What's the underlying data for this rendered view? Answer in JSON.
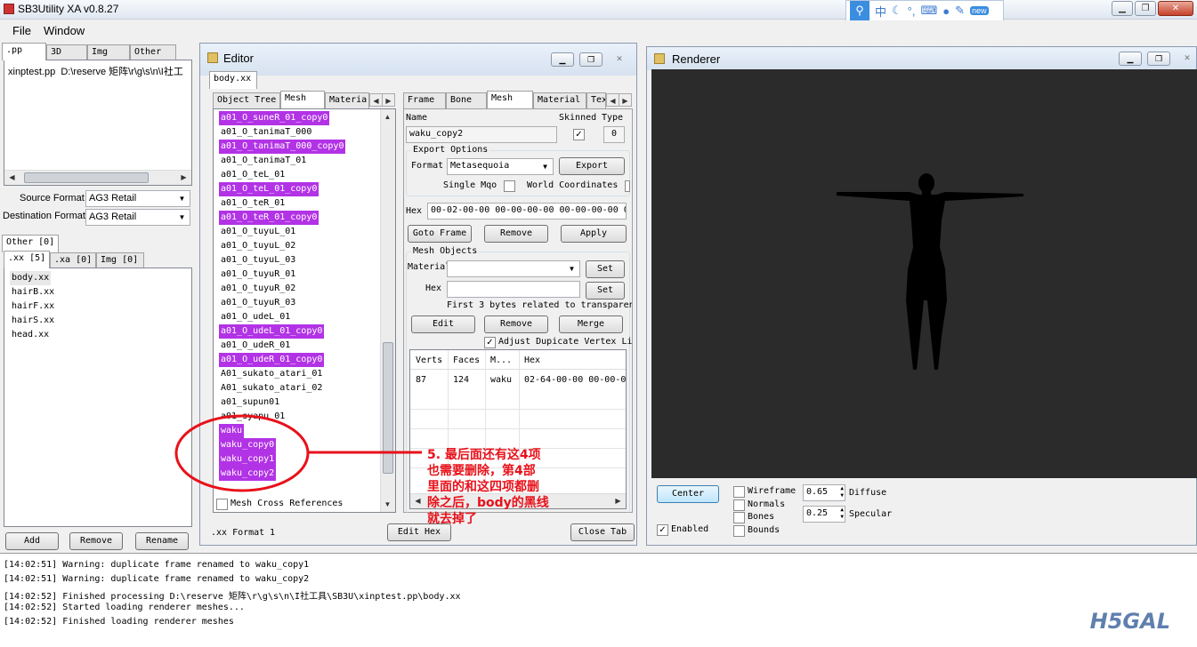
{
  "app": {
    "title": "SB3Utility XA v0.8.27"
  },
  "ime": {
    "items": [
      "中",
      "☾",
      "°,",
      "⌨",
      "●",
      "✎",
      "new"
    ]
  },
  "menu": {
    "file": "File",
    "window": "Window"
  },
  "pp": {
    "tabs": [
      ".pp",
      "3D",
      "Img",
      "Other"
    ],
    "file_name": "xinptest.pp",
    "file_path": "D:\\reserve 矩阵\\r\\g\\s\\n\\I社工",
    "source_format_label": "Source Format",
    "source_format_value": "AG3 Retail",
    "dest_format_label": "Destination Format",
    "dest_format_value": "AG3 Retail",
    "other_tab": "Other [0]",
    "sub_tabs": [
      ".xx [5]",
      ".xa [0]",
      "Img [0]"
    ],
    "files": [
      "body.xx",
      "hairB.xx",
      "hairF.xx",
      "hairS.xx",
      "head.xx"
    ],
    "add": "Add",
    "remove": "Remove",
    "rename": "Rename"
  },
  "editor": {
    "title": "Editor",
    "doc_tab": "body.xx",
    "left_tabs": [
      "Object Tree",
      "Mesh",
      "Materia"
    ],
    "mesh_list": [
      {
        "name": "a01_O_suneR_01_copy0",
        "hl": true
      },
      {
        "name": "a01_O_tanimaT_000",
        "hl": false
      },
      {
        "name": "a01_O_tanimaT_000_copy0",
        "hl": true
      },
      {
        "name": "a01_O_tanimaT_01",
        "hl": false
      },
      {
        "name": "a01_O_teL_01",
        "hl": false
      },
      {
        "name": "a01_O_teL_01_copy0",
        "hl": true
      },
      {
        "name": "a01_O_teR_01",
        "hl": false
      },
      {
        "name": "a01_O_teR_01_copy0",
        "hl": true
      },
      {
        "name": "a01_O_tuyuL_01",
        "hl": false
      },
      {
        "name": "a01_O_tuyuL_02",
        "hl": false
      },
      {
        "name": "a01_O_tuyuL_03",
        "hl": false
      },
      {
        "name": "a01_O_tuyuR_01",
        "hl": false
      },
      {
        "name": "a01_O_tuyuR_02",
        "hl": false
      },
      {
        "name": "a01_O_tuyuR_03",
        "hl": false
      },
      {
        "name": "a01_O_udeL_01",
        "hl": false
      },
      {
        "name": "a01_O_udeL_01_copy0",
        "hl": true
      },
      {
        "name": "a01_O_udeR_01",
        "hl": false
      },
      {
        "name": "a01_O_udeR_01_copy0",
        "hl": true
      },
      {
        "name": "A01_sukato_atari_01",
        "hl": false
      },
      {
        "name": "A01_sukato_atari_02",
        "hl": false
      },
      {
        "name": "a01_supun01",
        "hl": false
      },
      {
        "name": "a01_syapu_01",
        "hl": false
      },
      {
        "name": "waku",
        "hl": true
      },
      {
        "name": "waku_copy0",
        "hl": true
      },
      {
        "name": "waku_copy1",
        "hl": true
      },
      {
        "name": "waku_copy2",
        "hl": true
      }
    ],
    "mesh_cross_refs": "Mesh Cross References",
    "right_tabs": [
      "Frame",
      "Bone",
      "Mesh",
      "Material",
      "Tex"
    ],
    "name_label": "Name",
    "name_value": "waku_copy2",
    "skinned_label": "Skinned",
    "skinned_checked": "✓",
    "type_label": "Type",
    "type_value": "0",
    "export_options": "Export Options",
    "format_label": "Format",
    "format_value": "Metasequoia",
    "export_btn": "Export",
    "single_mqo": "Single Mqo",
    "world_coords": "World Coordinates",
    "hex_label": "Hex",
    "hex_value": "00-02-00-00 00-00-00-00 00-00-00-00 0",
    "goto_frame": "Goto Frame",
    "remove_btn": "Remove",
    "apply_btn": "Apply",
    "mesh_objects": "Mesh Objects",
    "material_label": "Material",
    "set1": "Set",
    "hex2_label": "Hex",
    "set2": "Set",
    "first3bytes": "First 3 bytes related to transparen",
    "edit_btn": "Edit",
    "remove2_btn": "Remove",
    "merge_btn": "Merge",
    "adjust_dup": "Adjust Dupicate Vertex Li",
    "adjust_checked": "✓",
    "grid_headers": [
      "Verts",
      "Faces",
      "M...",
      "Hex"
    ],
    "grid_row": [
      "87",
      "124",
      "waku",
      "02-64-00-00 00-00-0"
    ],
    "xx_format_label": ".xx Format",
    "xx_format_value": "1",
    "edit_hex": "Edit Hex",
    "close_tab": "Close Tab"
  },
  "renderer": {
    "title": "Renderer",
    "center": "Center",
    "enabled": "Enabled",
    "enabled_checked": "✓",
    "wireframe": "Wireframe",
    "normals": "Normals",
    "bones": "Bones",
    "bounds": "Bounds",
    "diffuse_value": "0.65",
    "diffuse_label": "Diffuse",
    "specular_value": "0.25",
    "specular_label": "Specular"
  },
  "annotation": {
    "lines": [
      "5. 最后面还有这4项",
      "也需要删除，第4部",
      "里面的和这四项都删",
      "除之后，body的黑线",
      "就去掉了"
    ],
    "color": "#e8111a"
  },
  "log": [
    "[14:02:51] Warning: duplicate frame renamed to waku_copy1",
    "[14:02:51] Warning: duplicate frame renamed to waku_copy2",
    "[14:02:52] Finished processing D:\\reserve 矩阵\\r\\g\\s\\n\\I社工具\\SB3U\\xinptest.pp\\body.xx",
    "[14:02:52] Started loading renderer meshes...",
    "[14:02:52] Finished loading renderer meshes"
  ],
  "watermark": "H5GAL"
}
